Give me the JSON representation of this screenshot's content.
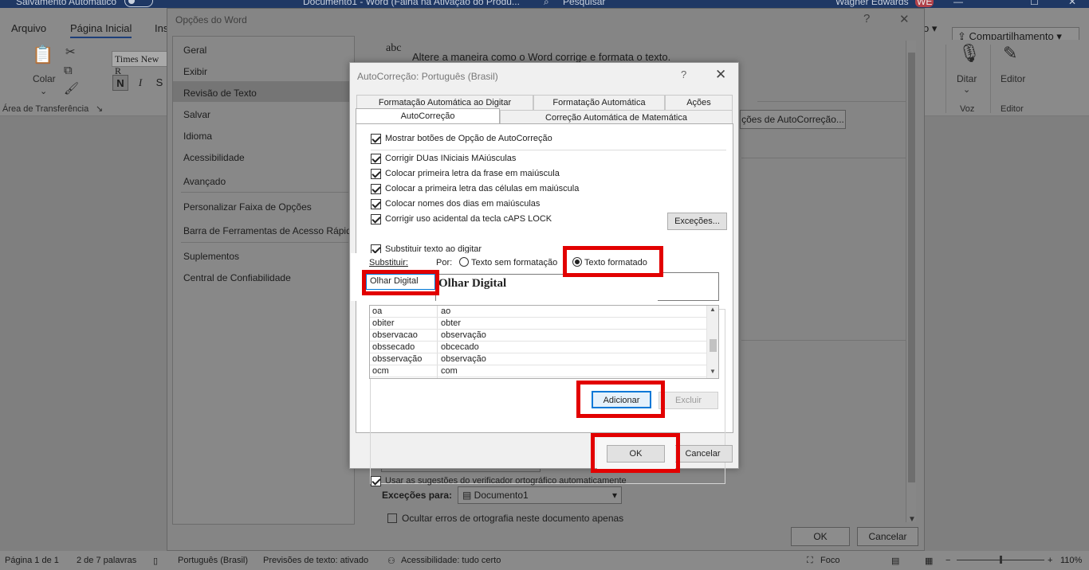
{
  "titlebar": {
    "autosave": "Salvamento Automático",
    "doc_title": "Documento1  -  Word (Falha na Ativação do Produ...",
    "search": "Pesquisar",
    "user": "Wagner Edwards",
    "initials": "WE"
  },
  "menu": {
    "arquivo": "Arquivo",
    "pagina_inicial": "Página Inicial",
    "ins": "Ins",
    "share": "Compartilhamento"
  },
  "ribbon": {
    "font": "Times New R",
    "colar": "Colar",
    "bold": "N",
    "italic": "I",
    "underline": "S",
    "clipboard_group": "Área de Transferência",
    "ditar": "Ditar",
    "voz": "Voz",
    "editor": "Editor",
    "editor_group": "Editor"
  },
  "opcoes": {
    "title": "Opções do Word",
    "help": "?",
    "close": "✕",
    "nav": [
      "Geral",
      "Exibir",
      "Revisão de Texto",
      "Salvar",
      "Idioma",
      "Acessibilidade",
      "Avançado",
      "Personalizar Faixa de Opções",
      "Barra de Ferramentas de Acesso Rápido",
      "Suplementos",
      "Central de Confiabilidade"
    ],
    "abc": "abc",
    "heading": "Altere a maneira como o Word corrige e formata o texto.",
    "autocorrect_btn": "ções de AutoCorreção...",
    "exceptions_label": "Exceções para:",
    "exceptions_value": "Documento1",
    "hide_errors": "Ocultar erros de ortografia neste documento apenas",
    "ok": "OK",
    "cancel": "Cancelar"
  },
  "autocorrecao": {
    "title": "AutoCorreção: Português (Brasil)",
    "help": "?",
    "close": "✕",
    "tabs_top": [
      "Formatação Automática ao Digitar",
      "Formatação Automática",
      "Ações"
    ],
    "tabs_bottom": [
      "AutoCorreção",
      "Correção Automática de Matemática"
    ],
    "show_buttons": "Mostrar botões de Opção de AutoCorreção",
    "checks": [
      "Corrigir DUas INiciais MAiúsculas",
      "Colocar primeira letra da frase em maiúscula",
      "Colocar a primeira letra das células em maiúscula",
      "Colocar nomes dos dias em maiúsculas",
      "Corrigir uso acidental da tecla cAPS LOCK"
    ],
    "exceptions_btn": "Exceções...",
    "replace_typing": "Substituir texto ao digitar",
    "substituir_label": "Substituir:",
    "por_label": "Por:",
    "plain_text": "Texto sem formatação",
    "formatted_text": "Texto formatado",
    "substituir_value": "Olhar Digital",
    "por_value": "Olhar Digital",
    "table": [
      {
        "from": "oa",
        "to": "ao"
      },
      {
        "from": "obiter",
        "to": "obter"
      },
      {
        "from": "observacao",
        "to": "observação"
      },
      {
        "from": "obssecado",
        "to": "obcecado"
      },
      {
        "from": "obsservação",
        "to": "observação"
      },
      {
        "from": "ocm",
        "to": "com"
      }
    ],
    "add_btn": "Adicionar",
    "delete_btn": "Excluir",
    "use_suggestions": "Usar as sugestões do verificador ortográfico automaticamente",
    "ok": "OK",
    "cancel": "Cancelar"
  },
  "status": {
    "page": "Página 1 de 1",
    "words": "2 de 7 palavras",
    "lang": "Português (Brasil)",
    "predictions": "Previsões de texto: ativado",
    "accessibility": "Acessibilidade: tudo certo",
    "focus": "Foco",
    "zoom": "110%"
  },
  "colors": {
    "highlight_red": "#e20000",
    "title_blue": "#1f3864",
    "focus_blue": "#0078d7"
  }
}
